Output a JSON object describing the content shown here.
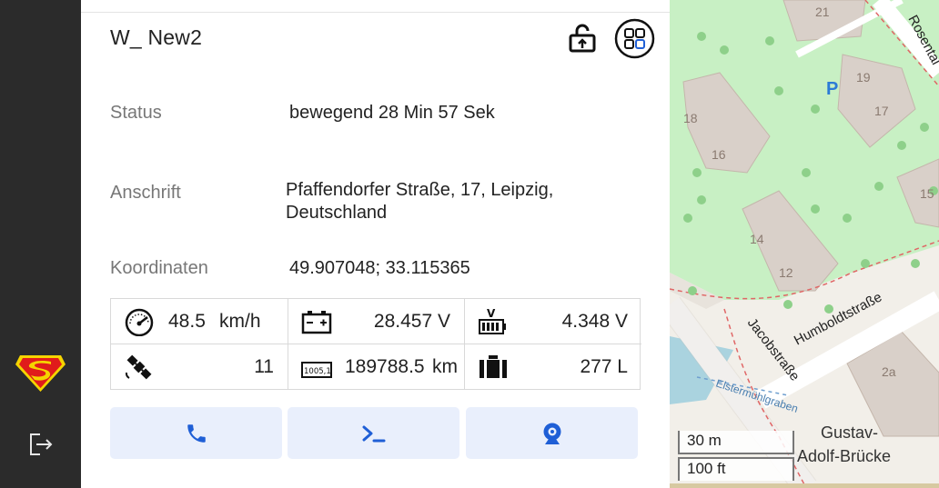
{
  "vehicle": {
    "title": "W_ New2"
  },
  "info": {
    "status_label": "Status",
    "status_value": "bewegend 28 Min 57 Sek",
    "address_label": "Anschrift",
    "address_line1": "Pfaffendorfer Straße, 17, Leipzig,",
    "address_line2": "Deutschland",
    "coords_label": "Koordinaten",
    "coords_value": "49.907048; 33.115365"
  },
  "sensors": {
    "speed_value": "48.5",
    "speed_unit": "km/h",
    "battery_value": "28.457 V",
    "battery_icon_label": "V",
    "voltage_value": "4.348 V",
    "satellites_value": "11",
    "odometer_icon_label": "1005,1",
    "odometer_value": "189788.5",
    "odometer_unit": "km",
    "fuel_value": "277 L"
  },
  "map": {
    "scale_metric": "30 m",
    "scale_imperial": "100 ft",
    "labels": {
      "street_humboldt": "Humboldtstraße",
      "street_jacob": "Jacobstraße",
      "street_rosental": "Rosental",
      "river": "Elstermühlgraben",
      "bridge_line1": "Gustav-",
      "bridge_line2": "Adolf-Brücke",
      "parking": "P",
      "h21": "21",
      "h19": "19",
      "h18": "18",
      "h17": "17",
      "h16": "16",
      "h15": "15",
      "h14": "14",
      "h12": "12",
      "h2a": "2a"
    }
  },
  "colors": {
    "sidebar": "#2b2b2b",
    "action_bg": "#e9effc",
    "action_icon": "#1f5fd6",
    "map_park": "#c8f0c4",
    "map_building": "#d9d0c9",
    "map_water": "#aad3df"
  }
}
